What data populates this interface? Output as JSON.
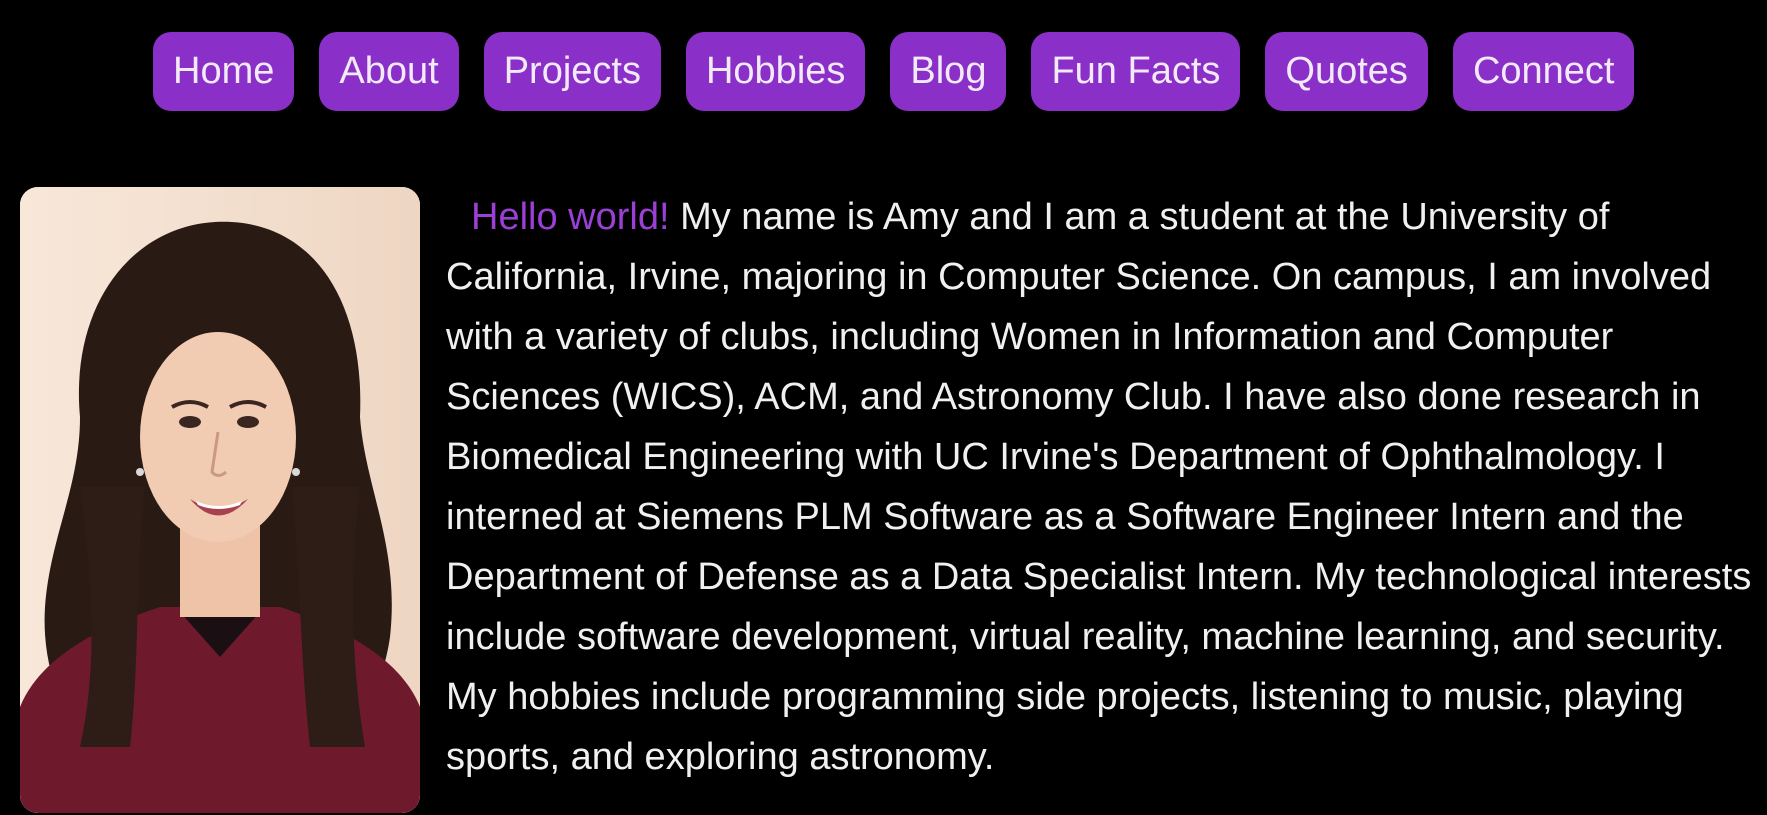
{
  "nav": {
    "items": [
      {
        "label": "Home"
      },
      {
        "label": "About"
      },
      {
        "label": "Projects"
      },
      {
        "label": "Hobbies"
      },
      {
        "label": "Blog"
      },
      {
        "label": "Fun Facts"
      },
      {
        "label": "Quotes"
      },
      {
        "label": "Connect"
      }
    ]
  },
  "profile": {
    "photo_icon": "portrait-photo"
  },
  "bio": {
    "greeting": "Hello world!",
    "text": "My name is Amy and I am a student at the University of California, Irvine, majoring in Computer Science. On campus, I am involved with a variety of clubs, including Women in Information and Computer Sciences (WICS), ACM, and Astronomy Club. I have also done research in Biomedical Engineering with UC Irvine's Department of Ophthalmology. I interned at Siemens PLM Software as a Software Engineer Intern and the Department of Defense as a Data Specialist Intern. My technological interests include software development, virtual reality, machine learning, and security. My hobbies include programming side projects, listening to music, playing sports, and exploring astronomy."
  },
  "colors": {
    "background": "#000000",
    "accent": "#8b2fc9",
    "greeting": "#9b3fd6",
    "text": "#f0f0f0"
  }
}
